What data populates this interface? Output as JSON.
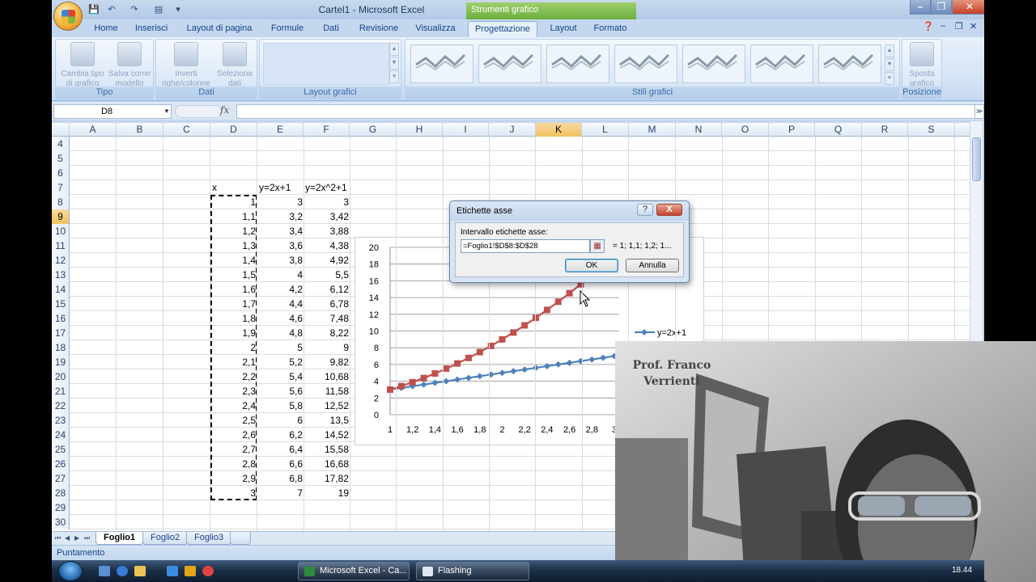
{
  "window": {
    "title": "Cartel1 - Microsoft Excel",
    "context_title": "Strumenti grafico"
  },
  "tabs": [
    "Home",
    "Inserisci",
    "Layout di pagina",
    "Formule",
    "Dati",
    "Revisione",
    "Visualizza",
    "Progettazione",
    "Layout",
    "Formato"
  ],
  "active_tab": "Progettazione",
  "ribbon": {
    "groups": {
      "tipo": {
        "label": "Tipo",
        "buttons": [
          "Cambia tipo di grafico",
          "Salva come modello"
        ]
      },
      "dati": {
        "label": "Dati",
        "buttons": [
          "Inverti righe/colonne",
          "Seleziona dati"
        ]
      },
      "layout": {
        "label": "Layout grafici"
      },
      "stili": {
        "label": "Stili grafici"
      },
      "posizione": {
        "label": "Posizione",
        "buttons": [
          "Sposta grafico"
        ]
      }
    },
    "b1_l1": "Cambia tipo",
    "b1_l2": "di grafico",
    "b2_l1": "Salva come",
    "b2_l2": "modello",
    "b3_l1": "Inverti",
    "b3_l2": "righe/colonne",
    "b4_l1": "Seleziona",
    "b4_l2": "dati",
    "b5_l1": "Sposta",
    "b5_l2": "grafico"
  },
  "formula_bar": {
    "name_box": "D8",
    "fx": "fx",
    "formula": ""
  },
  "columns": [
    "A",
    "B",
    "C",
    "D",
    "E",
    "F",
    "G",
    "H",
    "I",
    "J",
    "K",
    "L",
    "M",
    "N",
    "O",
    "P",
    "Q",
    "R",
    "S"
  ],
  "selected_column": "K",
  "selected_row": "9",
  "rows": [
    "4",
    "5",
    "6",
    "7",
    "8",
    "9",
    "10",
    "11",
    "12",
    "13",
    "14",
    "15",
    "16",
    "17",
    "18",
    "19",
    "20",
    "21",
    "22",
    "23",
    "24",
    "25",
    "26",
    "27",
    "28",
    "29",
    "30"
  ],
  "table": {
    "headers": {
      "x": "x",
      "y1": "y=2x+1",
      "y2": "y=2x^2+1"
    },
    "x": [
      "1",
      "1,1",
      "1,2",
      "1,3",
      "1,4",
      "1,5",
      "1,6",
      "1,7",
      "1,8",
      "1,9",
      "2",
      "2,1",
      "2,2",
      "2,3",
      "2,4",
      "2,5",
      "2,6",
      "2,7",
      "2,8",
      "2,9",
      "3"
    ],
    "y1": [
      "3",
      "3,2",
      "3,4",
      "3,6",
      "3,8",
      "4",
      "4,2",
      "4,4",
      "4,6",
      "4,8",
      "5",
      "5,2",
      "5,4",
      "5,6",
      "5,8",
      "6",
      "6,2",
      "6,4",
      "6,6",
      "6,8",
      "7"
    ],
    "y2": [
      "3",
      "3,42",
      "3,88",
      "4,38",
      "4,92",
      "5,5",
      "6,12",
      "6,78",
      "7,48",
      "8,22",
      "9",
      "9,82",
      "10,68",
      "11,58",
      "12,52",
      "13,5",
      "14,52",
      "15,58",
      "16,68",
      "17,82",
      "19"
    ]
  },
  "chart_data": {
    "type": "line",
    "categories": [
      "1",
      "1,1",
      "1,2",
      "1,3",
      "1,4",
      "1,5",
      "1,6",
      "1,7",
      "1,8",
      "1,9",
      "2",
      "2,1",
      "2,2",
      "2,3",
      "2,4",
      "2,5",
      "2,6",
      "2,7",
      "2,8",
      "2,9",
      "3"
    ],
    "x_tick_labels": [
      "1",
      "1,2",
      "1,4",
      "1,6",
      "1,8",
      "2",
      "2,2",
      "2,4",
      "2,6",
      "2,8",
      "3"
    ],
    "y_ticks": [
      "0",
      "2",
      "4",
      "6",
      "8",
      "10",
      "12",
      "14",
      "16",
      "18",
      "20"
    ],
    "ylim": [
      0,
      20
    ],
    "grid": true,
    "legend": "right",
    "series": [
      {
        "name": "y=2x+1",
        "color": "#4f81bd",
        "values": [
          3,
          3.2,
          3.4,
          3.6,
          3.8,
          4,
          4.2,
          4.4,
          4.6,
          4.8,
          5,
          5.2,
          5.4,
          5.6,
          5.8,
          6,
          6.2,
          6.4,
          6.6,
          6.8,
          7
        ]
      },
      {
        "name": "y=2x^2+1",
        "color": "#c0504d",
        "values": [
          3,
          3.42,
          3.88,
          4.38,
          4.92,
          5.5,
          6.12,
          6.78,
          7.48,
          8.22,
          9,
          9.82,
          10.68,
          11.58,
          12.52,
          13.5,
          14.52,
          15.58,
          16.68,
          17.82,
          19
        ]
      }
    ]
  },
  "dialog": {
    "title": "Etichette asse",
    "help": "?",
    "close": "X",
    "label": "Intervallo etichette asse:",
    "input_value": "=Foglio1!$D$8:$D$28",
    "preview": "= 1; 1,1; 1,2; 1...",
    "ok": "OK",
    "cancel": "Annulla"
  },
  "sheets": [
    "Foglio1",
    "Foglio2",
    "Foglio3"
  ],
  "active_sheet": "Foglio1",
  "status": "Puntamento",
  "taskbar": {
    "tasks": [
      "Microsoft Excel - Ca...",
      "Flashing"
    ],
    "clock": "18.44"
  },
  "webcam": {
    "name_line1": "Prof. Franco",
    "name_line2": "Verrienti"
  }
}
